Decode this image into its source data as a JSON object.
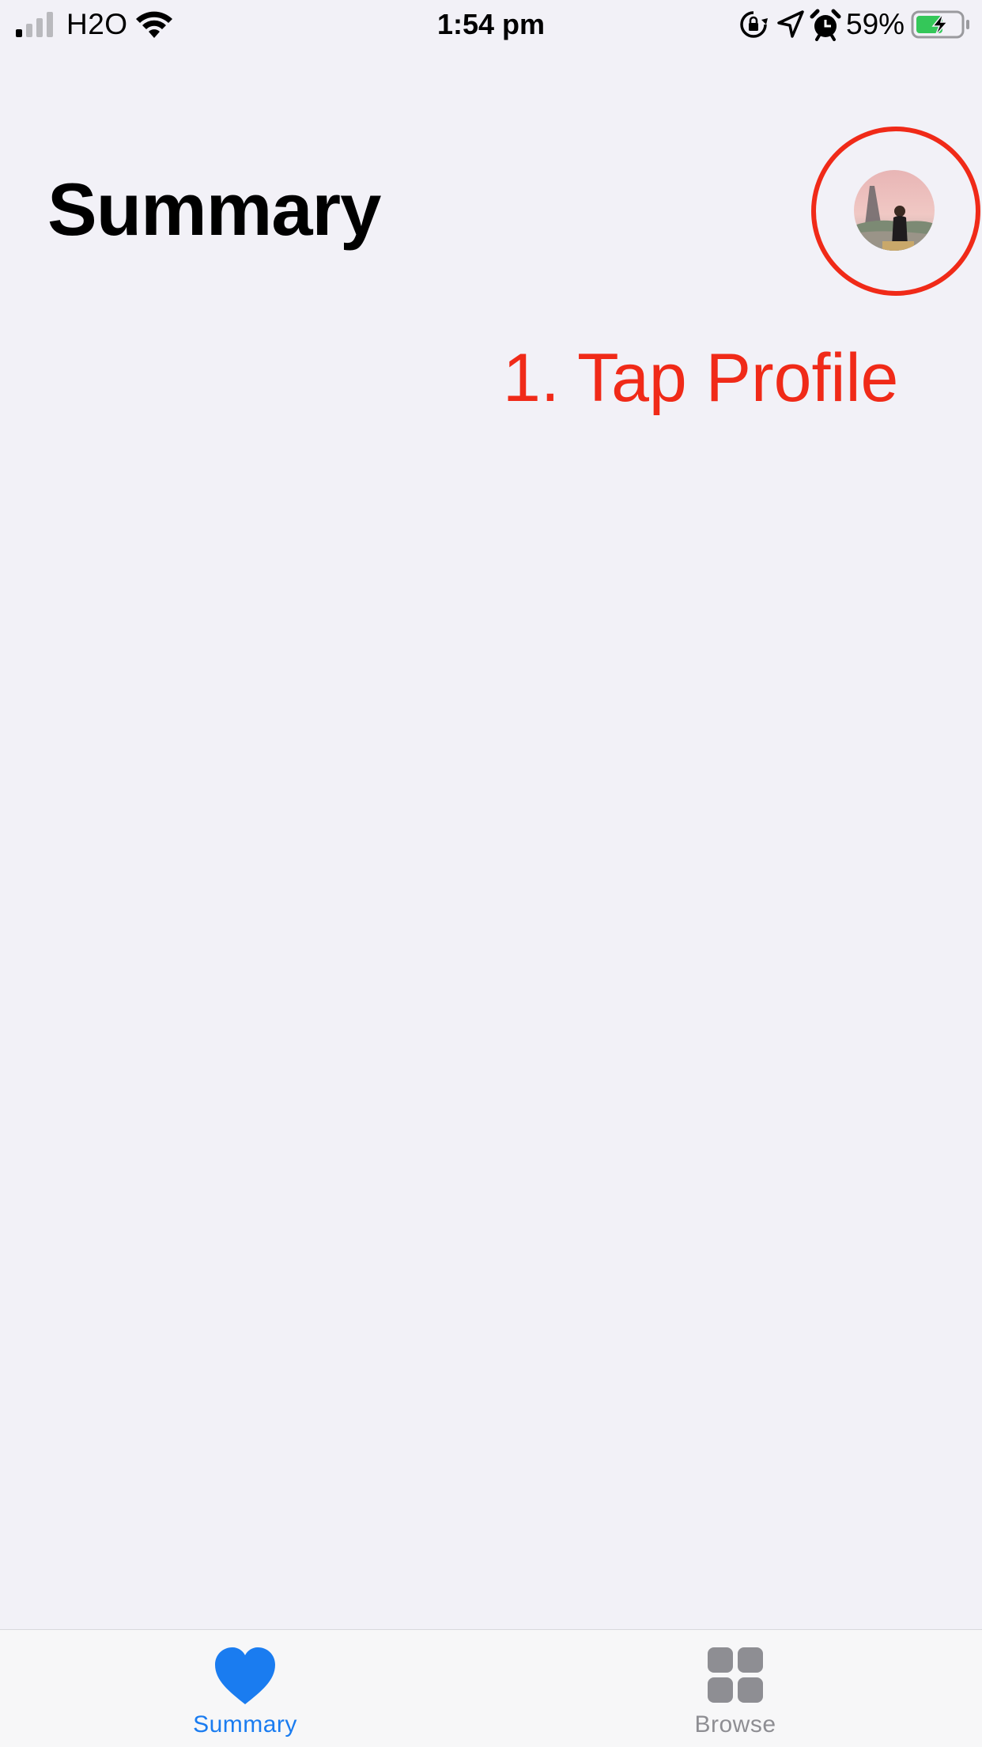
{
  "status_bar": {
    "carrier": "H2O",
    "time": "1:54 pm",
    "battery_percent": "59%",
    "battery_level": 0.59,
    "icons": [
      "signal-icon",
      "wifi-icon",
      "orientation-lock-icon",
      "location-icon",
      "alarm-icon",
      "battery-charging-icon"
    ]
  },
  "header": {
    "title": "Summary"
  },
  "annotation": {
    "label": "1. Tap Profile",
    "color": "#f02a18"
  },
  "tab_bar": {
    "tabs": [
      {
        "label": "Summary",
        "icon": "heart-icon",
        "selected": true
      },
      {
        "label": "Browse",
        "icon": "grid-icon",
        "selected": false
      }
    ],
    "accent_color": "#1a7cf0",
    "inactive_color": "#8e8e93"
  },
  "colors": {
    "background": "#f2f1f7"
  }
}
